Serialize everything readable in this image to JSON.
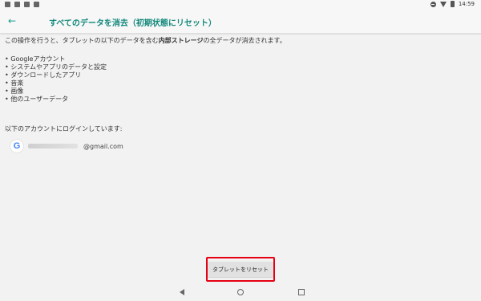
{
  "status_bar": {
    "left_icons": [
      "screenshot-icon",
      "gallery-icon",
      "image-icon",
      "play-store-icon"
    ],
    "right_icons": [
      "do-not-disturb-icon",
      "wifi-icon",
      "battery-icon"
    ],
    "time": "14:59"
  },
  "app_bar": {
    "back_icon": "arrow-left-icon",
    "title": "すべてのデータを消去（初期状態にリセット）"
  },
  "content": {
    "intro_prefix": "この操作を行うと、タブレットの以下のデータを含む",
    "intro_bold": "内部ストレージ",
    "intro_suffix": "の全データが消去されます。",
    "items": [
      "• Googleアカウント",
      "• システムやアプリのデータと設定",
      "• ダウンロードしたアプリ",
      "• 音楽",
      "• 画像",
      "• 他のユーザーデータ"
    ],
    "accounts_title": "以下のアカウントにログインしています:",
    "account": {
      "icon": "google-icon",
      "email_suffix": "@gmail.com"
    }
  },
  "reset_button": {
    "label": "タブレットをリセット",
    "highlight_color": "#e60012"
  },
  "nav_bar": {
    "icons": [
      "back-triangle-icon",
      "home-circle-icon",
      "recents-square-icon"
    ]
  },
  "colors": {
    "accent": "#13897c",
    "background": "#f2f2f2"
  }
}
